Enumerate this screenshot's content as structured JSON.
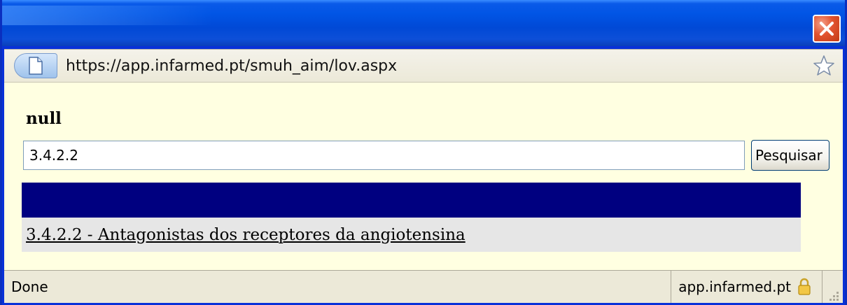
{
  "window": {
    "close_icon": "close-icon"
  },
  "address_bar": {
    "url": "https://app.infarmed.pt/smuh_aim/lov.aspx",
    "page_icon": "page-icon",
    "bookmark_icon": "star-icon"
  },
  "content": {
    "label": "null",
    "search_value": "3.4.2.2",
    "search_button": "Pesquisar",
    "results": [
      {
        "text": "3.4.2.2 - Antagonistas dos receptores da angiotensina"
      }
    ]
  },
  "status_bar": {
    "status": "Done",
    "domain": "app.infarmed.pt",
    "lock_icon": "lock-icon"
  },
  "colors": {
    "titlebar": "#0155e5",
    "content_bg": "#ffffe1",
    "results_header": "#000080",
    "results_row": "#e6e6e6"
  }
}
